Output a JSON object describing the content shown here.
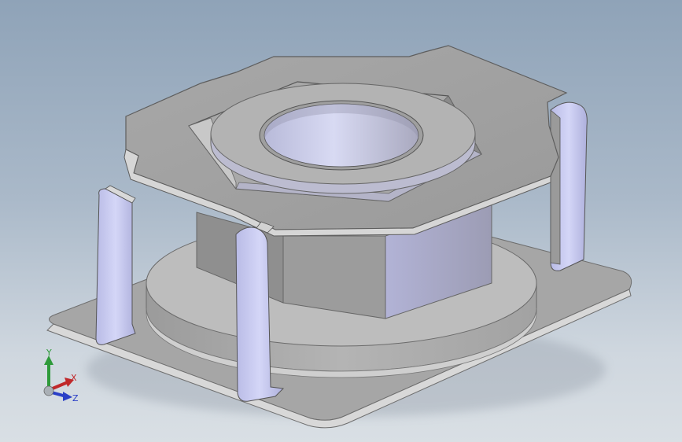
{
  "viewport": {
    "background_top": "#8fa3b8",
    "background_bottom": "#d9dfe4",
    "model_color": "#a3a3a3",
    "highlight_color": "#c9cbf2"
  },
  "triad": {
    "y_label": "Y",
    "x_label": "X",
    "z_label": "Z",
    "y_color": "#2e9a3a",
    "x_color": "#c0282a",
    "z_color": "#2a3fc7"
  }
}
